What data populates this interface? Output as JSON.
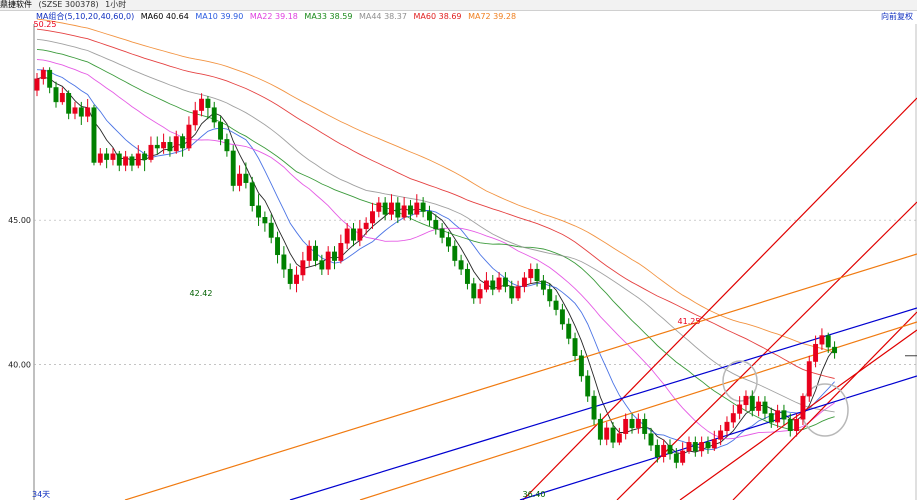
{
  "header": {
    "stock_name": "鼎捷软件",
    "code": "(SZSE 300378)",
    "period": "1小时",
    "ma_group": "MA组合(5,10,20,40,60,0)",
    "restore": "向前复权",
    "bottom_label": "34天"
  },
  "ma_legend": [
    {
      "label": "MA60 40.64",
      "color": "#000000"
    },
    {
      "label": "MA10 39.90",
      "color": "#2b5ce0"
    },
    {
      "label": "MA22 39.18",
      "color": "#e040e0"
    },
    {
      "label": "MA33 38.59",
      "color": "#1a8a1a"
    },
    {
      "label": "MA44 38.37",
      "color": "#909090"
    },
    {
      "label": "MA60 38.69",
      "color": "#e02020"
    },
    {
      "label": "MA72 39.28",
      "color": "#f08020"
    }
  ],
  "colors": {
    "up": "#e8001c",
    "down": "#008000",
    "grid": "#b0b0b0"
  },
  "chart_data": {
    "type": "candlestick",
    "ylim": [
      35.3,
      51.8
    ],
    "yticks": [
      "45.00",
      "40.00"
    ],
    "annotations": {
      "high_left": "50.25",
      "low_mid": "42.42",
      "high_right": "41.25",
      "low_bottom": "36.40"
    },
    "candles": [
      [
        49.5,
        49.9,
        50.1,
        49.3
      ],
      [
        49.9,
        50.2,
        50.3,
        49.7
      ],
      [
        50.2,
        49.6,
        50.3,
        49.4
      ],
      [
        49.6,
        49.1,
        49.8,
        48.9
      ],
      [
        49.1,
        49.4,
        49.6,
        49.0
      ],
      [
        49.4,
        48.7,
        49.5,
        48.5
      ],
      [
        48.7,
        48.9,
        49.1,
        48.5
      ],
      [
        48.9,
        48.6,
        49.1,
        48.3
      ],
      [
        48.6,
        48.9,
        49.2,
        48.4
      ],
      [
        48.9,
        47.0,
        49.0,
        46.9
      ],
      [
        47.0,
        47.3,
        47.5,
        46.9
      ],
      [
        47.3,
        47.1,
        47.5,
        46.8
      ],
      [
        47.1,
        47.3,
        47.5,
        46.9
      ],
      [
        47.3,
        46.9,
        47.4,
        46.7
      ],
      [
        46.9,
        47.2,
        47.4,
        46.7
      ],
      [
        47.2,
        46.9,
        47.3,
        46.7
      ],
      [
        46.9,
        47.3,
        47.6,
        46.8
      ],
      [
        47.3,
        47.1,
        47.4,
        46.7
      ],
      [
        47.1,
        47.6,
        47.9,
        47.0
      ],
      [
        47.6,
        47.5,
        47.9,
        47.3
      ],
      [
        47.5,
        47.7,
        48.0,
        47.3
      ],
      [
        47.7,
        47.4,
        47.9,
        47.2
      ],
      [
        47.4,
        47.9,
        48.1,
        47.3
      ],
      [
        47.9,
        47.5,
        48.0,
        47.2
      ],
      [
        47.5,
        48.3,
        48.6,
        47.4
      ],
      [
        48.3,
        48.8,
        49.1,
        48.1
      ],
      [
        48.8,
        49.2,
        49.4,
        48.6
      ],
      [
        49.2,
        48.9,
        49.3,
        48.5
      ],
      [
        48.9,
        48.4,
        49.1,
        48.2
      ],
      [
        48.4,
        47.8,
        48.6,
        47.6
      ],
      [
        47.8,
        47.4,
        48.0,
        47.2
      ],
      [
        47.4,
        46.2,
        47.6,
        46.0
      ],
      [
        46.2,
        46.6,
        46.9,
        46.0
      ],
      [
        46.6,
        46.3,
        47.0,
        46.1
      ],
      [
        46.3,
        45.5,
        46.5,
        45.3
      ],
      [
        45.5,
        45.1,
        45.9,
        44.8
      ],
      [
        45.1,
        44.9,
        45.3,
        44.6
      ],
      [
        44.9,
        44.4,
        45.2,
        44.2
      ],
      [
        44.4,
        43.8,
        44.6,
        43.5
      ],
      [
        43.8,
        43.3,
        44.1,
        43.0
      ],
      [
        43.3,
        42.8,
        43.5,
        42.6
      ],
      [
        42.8,
        43.1,
        43.4,
        42.5
      ],
      [
        43.1,
        43.6,
        43.9,
        42.9
      ],
      [
        43.6,
        44.1,
        44.3,
        43.4
      ],
      [
        44.1,
        43.6,
        44.3,
        43.4
      ],
      [
        43.6,
        43.3,
        43.8,
        43.1
      ],
      [
        43.3,
        43.9,
        44.1,
        43.1
      ],
      [
        43.9,
        43.6,
        44.1,
        43.3
      ],
      [
        43.6,
        44.2,
        44.5,
        43.5
      ],
      [
        44.2,
        44.7,
        44.9,
        44.0
      ],
      [
        44.7,
        44.3,
        44.9,
        44.1
      ],
      [
        44.3,
        44.7,
        45.0,
        44.1
      ],
      [
        44.7,
        44.9,
        45.1,
        44.5
      ],
      [
        44.9,
        45.3,
        45.6,
        44.7
      ],
      [
        45.3,
        45.6,
        45.8,
        45.1
      ],
      [
        45.6,
        45.2,
        45.8,
        45.0
      ],
      [
        45.2,
        45.6,
        45.9,
        45.0
      ],
      [
        45.6,
        45.1,
        45.8,
        44.9
      ],
      [
        45.1,
        45.5,
        45.8,
        45.0
      ],
      [
        45.5,
        45.2,
        45.7,
        45.0
      ],
      [
        45.2,
        45.6,
        45.9,
        45.1
      ],
      [
        45.6,
        45.3,
        45.8,
        45.1
      ],
      [
        45.3,
        45.0,
        45.5,
        44.8
      ],
      [
        45.0,
        44.7,
        45.2,
        44.5
      ],
      [
        44.7,
        44.4,
        44.9,
        44.2
      ],
      [
        44.4,
        44.1,
        44.6,
        43.9
      ],
      [
        44.1,
        43.6,
        44.3,
        43.4
      ],
      [
        43.6,
        43.3,
        43.8,
        43.1
      ],
      [
        43.3,
        42.8,
        43.5,
        42.6
      ],
      [
        42.8,
        42.3,
        43.0,
        42.1
      ],
      [
        42.3,
        42.6,
        42.8,
        42.1
      ],
      [
        42.6,
        42.9,
        43.2,
        42.5
      ],
      [
        42.9,
        42.6,
        43.1,
        42.4
      ],
      [
        42.6,
        43.0,
        43.2,
        42.5
      ],
      [
        43.0,
        42.7,
        43.2,
        42.5
      ],
      [
        42.7,
        42.3,
        42.9,
        42.1
      ],
      [
        42.3,
        42.7,
        42.9,
        42.2
      ],
      [
        42.7,
        43.0,
        43.2,
        42.5
      ],
      [
        43.0,
        43.3,
        43.5,
        42.8
      ],
      [
        43.3,
        42.9,
        43.5,
        42.7
      ],
      [
        42.9,
        42.6,
        43.1,
        42.4
      ],
      [
        42.6,
        42.2,
        42.8,
        42.0
      ],
      [
        42.2,
        41.9,
        42.4,
        41.7
      ],
      [
        41.9,
        41.4,
        42.1,
        41.2
      ],
      [
        41.4,
        40.9,
        41.6,
        40.7
      ],
      [
        40.9,
        40.3,
        41.1,
        40.1
      ],
      [
        40.3,
        39.6,
        40.5,
        39.4
      ],
      [
        39.6,
        38.9,
        39.8,
        38.7
      ],
      [
        38.9,
        38.1,
        39.1,
        37.9
      ],
      [
        38.1,
        37.4,
        38.3,
        37.2
      ],
      [
        37.4,
        37.8,
        38.0,
        37.2
      ],
      [
        37.8,
        37.3,
        38.0,
        37.1
      ],
      [
        37.3,
        37.6,
        37.8,
        37.2
      ],
      [
        37.6,
        38.1,
        38.3,
        37.4
      ],
      [
        38.1,
        37.8,
        38.3,
        37.6
      ],
      [
        37.8,
        38.1,
        38.3,
        37.6
      ],
      [
        38.1,
        37.6,
        38.3,
        37.4
      ],
      [
        37.6,
        37.2,
        37.8,
        37.0
      ],
      [
        37.2,
        36.8,
        37.4,
        36.6
      ],
      [
        36.8,
        37.2,
        37.4,
        36.6
      ],
      [
        37.2,
        36.9,
        37.4,
        36.7
      ],
      [
        36.9,
        36.6,
        37.1,
        36.4
      ],
      [
        36.6,
        37.0,
        37.3,
        36.5
      ],
      [
        37.0,
        37.3,
        37.5,
        36.9
      ],
      [
        37.3,
        37.0,
        37.5,
        36.8
      ],
      [
        37.0,
        37.3,
        37.5,
        36.8
      ],
      [
        37.3,
        37.1,
        37.5,
        36.9
      ],
      [
        37.1,
        37.4,
        37.7,
        37.0
      ],
      [
        37.4,
        37.7,
        37.9,
        37.2
      ],
      [
        37.7,
        38.0,
        38.2,
        37.5
      ],
      [
        38.0,
        38.3,
        38.6,
        37.8
      ],
      [
        38.3,
        38.6,
        38.9,
        38.1
      ],
      [
        38.6,
        38.9,
        39.1,
        38.4
      ],
      [
        38.9,
        38.4,
        39.1,
        38.2
      ],
      [
        38.4,
        38.7,
        38.9,
        38.2
      ],
      [
        38.7,
        38.3,
        38.9,
        38.1
      ],
      [
        38.3,
        38.0,
        38.5,
        37.8
      ],
      [
        38.0,
        38.4,
        38.6,
        37.8
      ],
      [
        38.4,
        38.1,
        38.6,
        37.9
      ],
      [
        38.1,
        37.7,
        38.3,
        37.5
      ],
      [
        37.7,
        38.1,
        38.3,
        37.5
      ],
      [
        38.1,
        38.9,
        39.0,
        37.9
      ],
      [
        38.9,
        40.1,
        40.3,
        38.7
      ],
      [
        40.1,
        40.7,
        41.0,
        39.9
      ],
      [
        40.7,
        41.0,
        41.25,
        40.5
      ],
      [
        41.0,
        40.6,
        41.1,
        40.4
      ],
      [
        40.6,
        40.4,
        40.8,
        40.2
      ]
    ]
  }
}
